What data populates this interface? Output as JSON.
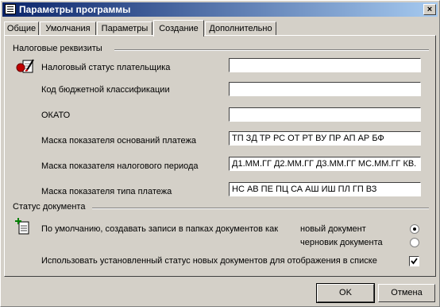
{
  "window": {
    "title": "Параметры программы",
    "close_glyph": "×"
  },
  "tabs": [
    {
      "label": "Общие"
    },
    {
      "label": "Умолчания"
    },
    {
      "label": "Параметры"
    },
    {
      "label": "Создание",
      "active": true
    },
    {
      "label": "Дополнительно"
    }
  ],
  "tax_section": {
    "title": "Налоговые реквизиты",
    "fields": [
      {
        "label": "Налоговый статус плательщика",
        "value": ""
      },
      {
        "label": "Код бюджетной классификации",
        "value": ""
      },
      {
        "label": "ОКАТО",
        "value": ""
      },
      {
        "label": "Маска показателя оснований платежа",
        "value": "ТП ЗД ТР РС ОТ РТ ВУ ПР АП АР БФ"
      },
      {
        "label": "Маска показателя налогового периода",
        "value": "Д1.ММ.ГГ Д2.ММ.ГГ Д3.ММ.ГГ МС.ММ.ГГ КВ."
      },
      {
        "label": "Маска показателя типа платежа",
        "value": "НС АВ ПЕ ПЦ СА АШ ИШ ПЛ ГП ВЗ"
      }
    ],
    "icon": "signature-document-icon"
  },
  "status_section": {
    "title": "Статус документа",
    "default_create_label": "По умолчанию, создавать записи в папках документов как",
    "options": [
      {
        "label": "новый документ",
        "checked": true
      },
      {
        "label": "черновик документа",
        "checked": false
      }
    ],
    "use_status_label": "Использовать установленный статус новых документов для отображения в списке",
    "use_status_checked": true,
    "icon": "new-document-icon"
  },
  "buttons": {
    "ok": "OK",
    "cancel": "Отмена"
  }
}
